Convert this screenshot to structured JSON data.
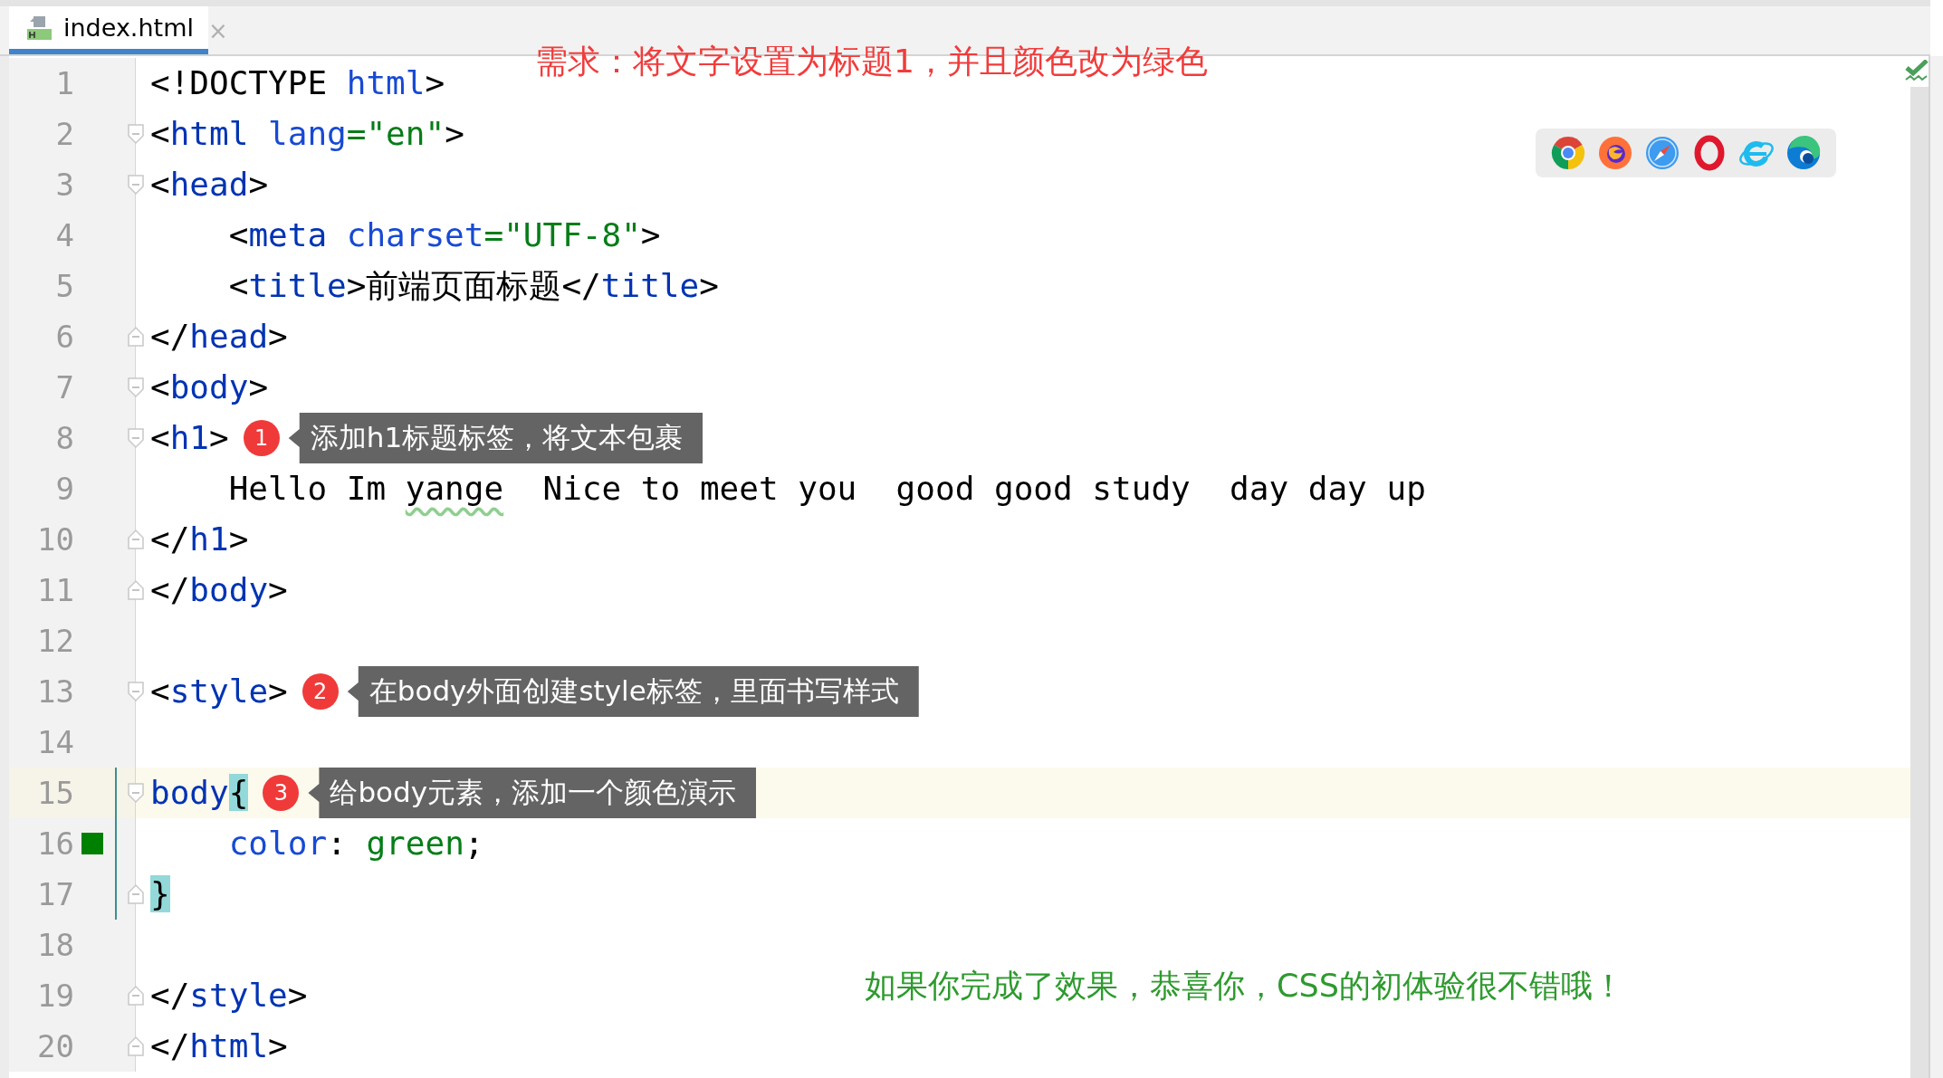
{
  "tab": {
    "title": "index.html",
    "close": "×",
    "selected": true
  },
  "requirement": "需求：将文字设置为标题1，并且颜色改为绿色",
  "editor": {
    "lines": [
      {
        "number": "1",
        "fold_start": false,
        "fold_end": false,
        "current": false,
        "scope": false,
        "tokens": [
          {
            "text": "<!DOCTYPE ",
            "kind": "punct"
          },
          {
            "text": "html",
            "kind": "attr"
          },
          {
            "text": ">",
            "kind": "punct"
          }
        ]
      },
      {
        "number": "2",
        "fold_start": true,
        "fold_end": false,
        "current": false,
        "scope": false,
        "tokens": [
          {
            "text": "<",
            "kind": "punct"
          },
          {
            "text": "html",
            "kind": "tag"
          },
          {
            "text": " lang",
            "kind": "attr"
          },
          {
            "text": "=\"en\"",
            "kind": "string"
          },
          {
            "text": ">",
            "kind": "punct"
          }
        ]
      },
      {
        "number": "3",
        "fold_start": true,
        "fold_end": false,
        "current": false,
        "scope": false,
        "tokens": [
          {
            "text": "<",
            "kind": "punct"
          },
          {
            "text": "head",
            "kind": "tag"
          },
          {
            "text": ">",
            "kind": "punct"
          }
        ]
      },
      {
        "number": "4",
        "fold_start": false,
        "fold_end": false,
        "current": false,
        "scope": false,
        "tokens": [
          {
            "text": "    <",
            "kind": "punct"
          },
          {
            "text": "meta",
            "kind": "tag"
          },
          {
            "text": " charset",
            "kind": "attr"
          },
          {
            "text": "=\"UTF-8\"",
            "kind": "string"
          },
          {
            "text": ">",
            "kind": "punct"
          }
        ]
      },
      {
        "number": "5",
        "fold_start": false,
        "fold_end": false,
        "current": false,
        "scope": false,
        "tokens": [
          {
            "text": "    <",
            "kind": "punct"
          },
          {
            "text": "title",
            "kind": "tag"
          },
          {
            "text": ">前端页面标题</",
            "kind": "punct"
          },
          {
            "text": "title",
            "kind": "tag"
          },
          {
            "text": ">",
            "kind": "punct"
          }
        ]
      },
      {
        "number": "6",
        "fold_start": false,
        "fold_end": true,
        "current": false,
        "scope": false,
        "tokens": [
          {
            "text": "</",
            "kind": "punct"
          },
          {
            "text": "head",
            "kind": "tag"
          },
          {
            "text": ">",
            "kind": "punct"
          }
        ]
      },
      {
        "number": "7",
        "fold_start": true,
        "fold_end": false,
        "current": false,
        "scope": false,
        "tokens": [
          {
            "text": "<",
            "kind": "punct"
          },
          {
            "text": "body",
            "kind": "tag"
          },
          {
            "text": ">",
            "kind": "punct"
          }
        ]
      },
      {
        "number": "8",
        "fold_start": true,
        "fold_end": false,
        "current": false,
        "scope": false,
        "tokens": [
          {
            "text": "<",
            "kind": "punct"
          },
          {
            "text": "h1",
            "kind": "tag"
          },
          {
            "text": ">",
            "kind": "punct"
          }
        ],
        "annotation": {
          "number": "1",
          "text": "添加h1标题标签，将文本包裹"
        }
      },
      {
        "number": "9",
        "fold_start": false,
        "fold_end": false,
        "current": false,
        "scope": false,
        "tokens": [
          {
            "text": "    Hello Im ",
            "kind": "punct"
          },
          {
            "text": "yange",
            "kind": "typo"
          },
          {
            "text": "  Nice to meet you  good good study  day day up",
            "kind": "punct"
          }
        ]
      },
      {
        "number": "10",
        "fold_start": false,
        "fold_end": true,
        "current": false,
        "scope": false,
        "tokens": [
          {
            "text": "</",
            "kind": "punct"
          },
          {
            "text": "h1",
            "kind": "tag"
          },
          {
            "text": ">",
            "kind": "punct"
          }
        ]
      },
      {
        "number": "11",
        "fold_start": false,
        "fold_end": true,
        "current": false,
        "scope": false,
        "tokens": [
          {
            "text": "</",
            "kind": "punct"
          },
          {
            "text": "body",
            "kind": "tag"
          },
          {
            "text": ">",
            "kind": "punct"
          }
        ]
      },
      {
        "number": "12",
        "fold_start": false,
        "fold_end": false,
        "current": false,
        "scope": false
      },
      {
        "number": "13",
        "fold_start": true,
        "fold_end": false,
        "current": false,
        "scope": false,
        "tokens": [
          {
            "text": "<",
            "kind": "punct"
          },
          {
            "text": "style",
            "kind": "tag"
          },
          {
            "text": ">",
            "kind": "punct"
          }
        ],
        "annotation": {
          "number": "2",
          "text": "在body外面创建style标签，里面书写样式"
        }
      },
      {
        "number": "14",
        "fold_start": false,
        "fold_end": false,
        "current": false,
        "scope": false
      },
      {
        "number": "15",
        "fold_start": true,
        "fold_end": false,
        "current": true,
        "scope": true,
        "tokens": [
          {
            "text": "body",
            "kind": "tag"
          },
          {
            "text": "{",
            "kind": "brace"
          }
        ],
        "annotation": {
          "number": "3",
          "text": "给body元素，添加一个颜色演示"
        }
      },
      {
        "number": "16",
        "fold_start": false,
        "fold_end": false,
        "current": false,
        "scope": true,
        "color": "#008000",
        "tokens": [
          {
            "text": "    color",
            "kind": "attr"
          },
          {
            "text": ": ",
            "kind": "punct"
          },
          {
            "text": "green",
            "kind": "string"
          },
          {
            "text": ";",
            "kind": "punct"
          }
        ]
      },
      {
        "number": "17",
        "fold_start": false,
        "fold_end": true,
        "current": false,
        "scope": true,
        "tokens": [
          {
            "text": "}",
            "kind": "brace"
          }
        ]
      },
      {
        "number": "18",
        "fold_start": false,
        "fold_end": false,
        "current": false,
        "scope": false
      },
      {
        "number": "19",
        "fold_start": false,
        "fold_end": true,
        "current": false,
        "scope": false,
        "tokens": [
          {
            "text": "</",
            "kind": "punct"
          },
          {
            "text": "style",
            "kind": "tag"
          },
          {
            "text": ">",
            "kind": "punct"
          }
        ]
      },
      {
        "number": "20",
        "fold_start": false,
        "fold_end": true,
        "current": false,
        "scope": false,
        "tokens": [
          {
            "text": "</",
            "kind": "punct"
          },
          {
            "text": "html",
            "kind": "tag"
          },
          {
            "text": ">",
            "kind": "punct"
          }
        ]
      }
    ]
  },
  "footer_note": "如果你完成了效果，恭喜你，CSS的初体验很不错哦！"
}
